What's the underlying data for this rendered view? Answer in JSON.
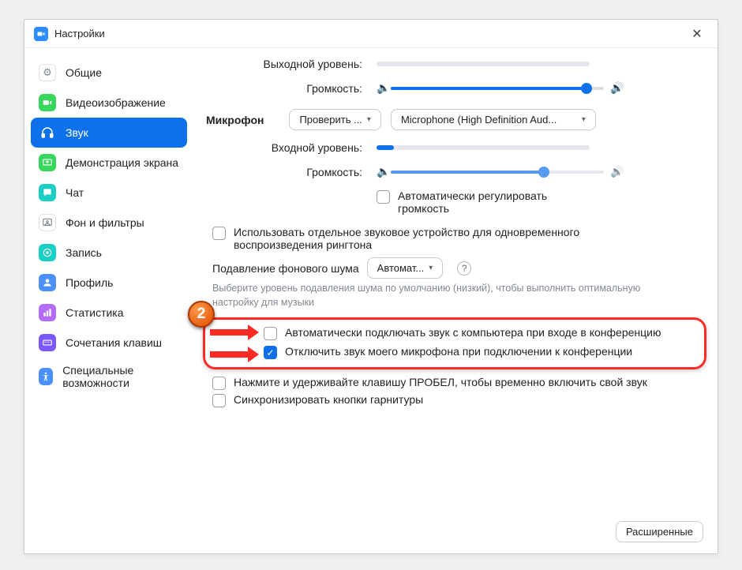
{
  "window": {
    "title": "Настройки"
  },
  "sidebar": {
    "items": [
      {
        "label": "Общие",
        "icon_bg": "#ffffff",
        "icon_fg": "#828892",
        "icon": "gear"
      },
      {
        "label": "Видеоизображение",
        "icon_bg": "#37d65c",
        "icon_fg": "#ffffff",
        "icon": "video"
      },
      {
        "label": "Звук",
        "icon_bg": "#0E71EB",
        "icon_fg": "#ffffff",
        "icon": "headphones",
        "active": true
      },
      {
        "label": "Демонстрация экрана",
        "icon_bg": "#37d65c",
        "icon_fg": "#ffffff",
        "icon": "share"
      },
      {
        "label": "Чат",
        "icon_bg": "#19cfc6",
        "icon_fg": "#ffffff",
        "icon": "chat"
      },
      {
        "label": "Фон и фильтры",
        "icon_bg": "#ffffff",
        "icon_fg": "#828892",
        "icon": "background"
      },
      {
        "label": "Запись",
        "icon_bg": "#19cfc6",
        "icon_fg": "#ffffff",
        "icon": "record"
      },
      {
        "label": "Профиль",
        "icon_bg": "#4a90ff",
        "icon_fg": "#ffffff",
        "icon": "profile"
      },
      {
        "label": "Статистика",
        "icon_bg": "#b66bff",
        "icon_fg": "#ffffff",
        "icon": "stats"
      },
      {
        "label": "Сочетания клавиш",
        "icon_bg": "#7b59ff",
        "icon_fg": "#ffffff",
        "icon": "keyboard"
      },
      {
        "label": "Специальные возможности",
        "icon_bg": "#4a90ff",
        "icon_fg": "#ffffff",
        "icon": "accessibility"
      }
    ]
  },
  "speaker": {
    "output_level_label": "Выходной уровень:",
    "volume_label": "Громкость:",
    "volume_pct": 92
  },
  "mic": {
    "section_label": "Микрофон",
    "test_btn": "Проверить ...",
    "device_selected": "Microphone (High Definition Aud...",
    "input_level_label": "Входной уровень:",
    "input_level_pct": 8,
    "volume_label": "Громкость:",
    "volume_pct": 72,
    "auto_volume_label": "Автоматически регулировать громкость",
    "auto_volume_checked": false
  },
  "ringtone": {
    "label": "Использовать отдельное звуковое устройство для одновременного воспроизведения рингтона",
    "checked": false
  },
  "noise": {
    "label": "Подавление фонового шума",
    "value": "Автомат...",
    "hint": "Выберите уровень подавления шума по умолчанию (низкий), чтобы выполнить оптимальную настройку для музыки"
  },
  "highlight": {
    "badge": "2",
    "opt1": {
      "label": "Автоматически подключать звук с компьютера при входе в конференцию",
      "checked": false
    },
    "opt2": {
      "label": "Отключить звук моего микрофона при подключении к конференции",
      "checked": true
    }
  },
  "opts_rest": [
    {
      "label": "Нажмите и удерживайте клавишу ПРОБЕЛ, чтобы временно включить свой звук",
      "checked": false
    },
    {
      "label": "Синхронизировать кнопки гарнитуры",
      "checked": false
    }
  ],
  "footer": {
    "advanced": "Расширенные"
  }
}
